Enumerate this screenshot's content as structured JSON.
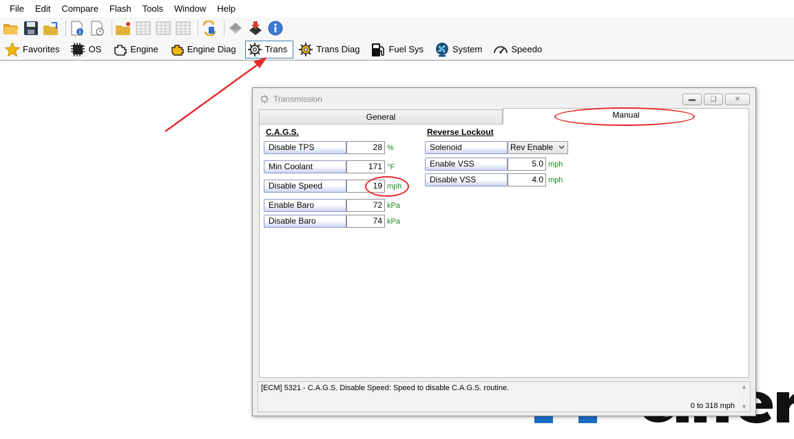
{
  "menu": [
    "File",
    "Edit",
    "Compare",
    "Flash",
    "Tools",
    "Window",
    "Help"
  ],
  "nav": {
    "items": [
      {
        "label": "Favorites",
        "icon": "star-icon"
      },
      {
        "label": "OS",
        "icon": "chip-icon"
      },
      {
        "label": "Engine",
        "icon": "engine-icon"
      },
      {
        "label": "Engine Diag",
        "icon": "engine-warning-icon"
      },
      {
        "label": "Trans",
        "icon": "gear-icon"
      },
      {
        "label": "Trans Diag",
        "icon": "gear-diag-icon"
      },
      {
        "label": "Fuel Sys",
        "icon": "fuel-pump-icon"
      },
      {
        "label": "System",
        "icon": "fan-icon"
      },
      {
        "label": "Speedo",
        "icon": "speedometer-icon"
      }
    ]
  },
  "window": {
    "title": "Transmission",
    "tabs": {
      "general": "General",
      "manual": "Manual"
    }
  },
  "cags": {
    "title": "C.A.G.S.",
    "rows": [
      {
        "label": "Disable TPS",
        "value": "28",
        "unit": "%"
      },
      {
        "label": "Min Coolant",
        "value": "171",
        "unit": "°F"
      },
      {
        "label": "Disable Speed",
        "value": "19",
        "unit": "mph"
      },
      {
        "label": "Enable Baro",
        "value": "72",
        "unit": "kPa"
      },
      {
        "label": "Disable Baro",
        "value": "74",
        "unit": "kPa"
      }
    ]
  },
  "reverse": {
    "title": "Reverse Lockout",
    "solenoid": {
      "label": "Solenoid",
      "value": "Rev Enable"
    },
    "rows": [
      {
        "label": "Enable VSS",
        "value": "5.0",
        "unit": "mph"
      },
      {
        "label": "Disable VSS",
        "value": "4.0",
        "unit": "mph"
      }
    ]
  },
  "info": {
    "description": "[ECM] 5321 - C.A.G.S. Disable Speed: Speed to disable C.A.G.S. routine.",
    "range": "0 to 318 mph"
  },
  "colors": {
    "annotation": "#e52b2b",
    "unit": "#1a8a1a",
    "label_gradient": "#cdd3f2",
    "active_nav_border": "#3c7fb1"
  }
}
